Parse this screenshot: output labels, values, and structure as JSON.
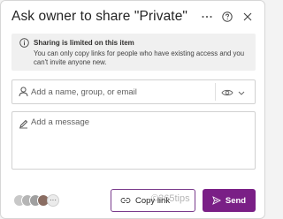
{
  "dialog": {
    "title": "Ask owner to share \"Private\"",
    "more_icon": "more-horizontal-icon",
    "help_icon": "help-circle-icon",
    "close_icon": "close-icon"
  },
  "banner": {
    "icon": "info-icon",
    "heading": "Sharing is limited on this item",
    "body": "You can only copy links for people who have existing access and you can't invite anyone new."
  },
  "to_field": {
    "icon": "person-icon",
    "placeholder": "Add a name, group, or email",
    "value": "",
    "permission_icon": "eye-icon",
    "dropdown_icon": "chevron-down-icon"
  },
  "message_field": {
    "icon": "pencil-icon",
    "placeholder": "Add a message",
    "value": ""
  },
  "footer": {
    "more_people_label": "···",
    "copy_link_label": "Copy link",
    "copy_link_icon": "link-icon",
    "send_label": "Send",
    "send_icon": "send-icon",
    "watermark": "©365tips"
  },
  "colors": {
    "accent": "#7a1f86",
    "copy_border": "#7a3b8c",
    "banner_bg": "#f0f0f0"
  }
}
